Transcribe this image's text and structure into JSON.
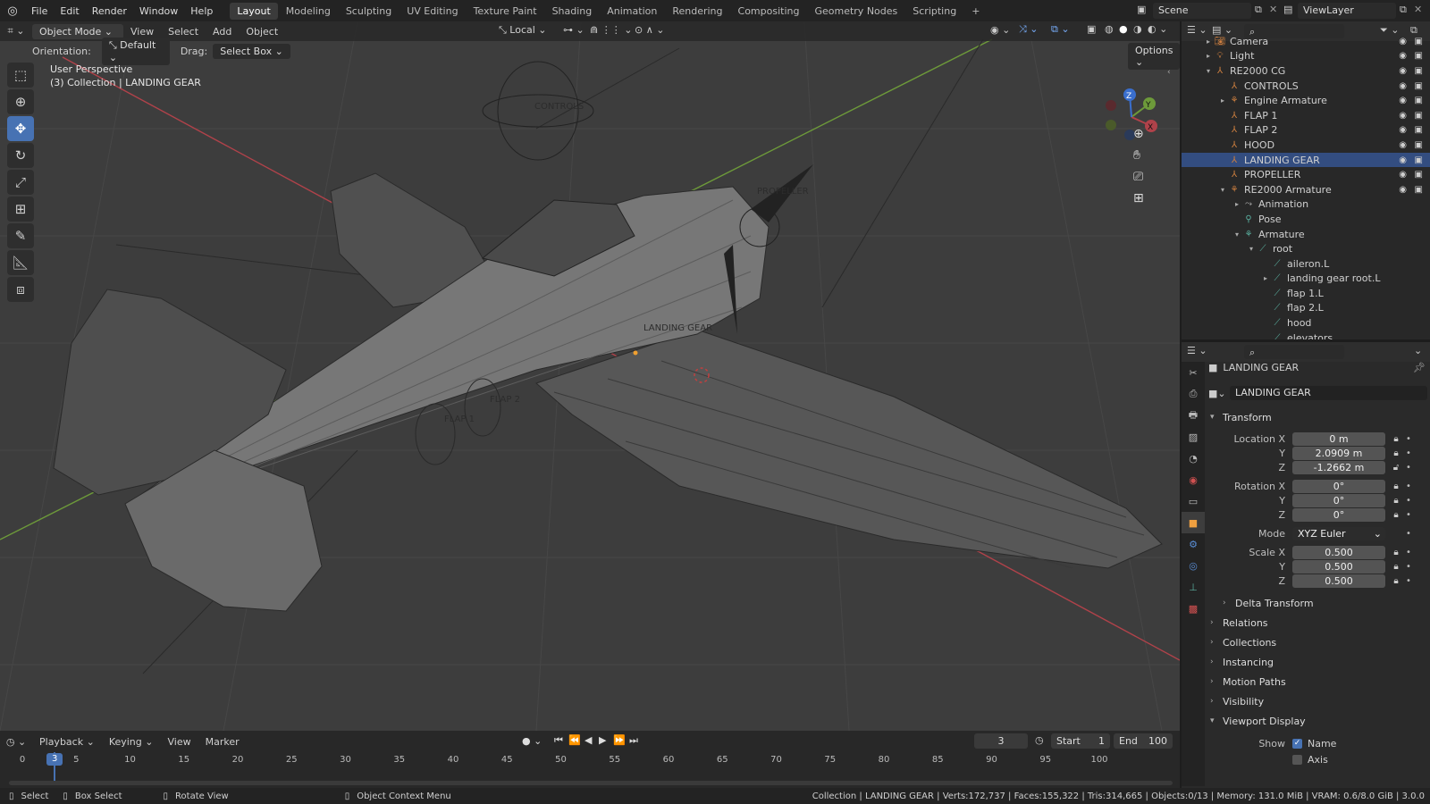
{
  "topbar": {
    "menus": [
      "File",
      "Edit",
      "Render",
      "Window",
      "Help"
    ],
    "workspaces": [
      "Layout",
      "Modeling",
      "Sculpting",
      "UV Editing",
      "Texture Paint",
      "Shading",
      "Animation",
      "Rendering",
      "Compositing",
      "Geometry Nodes",
      "Scripting"
    ],
    "active_workspace": "Layout",
    "add_tab": "+",
    "scene": "Scene",
    "view_layer": "ViewLayer"
  },
  "viewport": {
    "mode": "Object Mode",
    "menus": [
      "View",
      "Select",
      "Add",
      "Object"
    ],
    "transform_space": "Local",
    "orientation_label": "Orientation:",
    "orientation_value": "Default",
    "drag_label": "Drag:",
    "drag_value": "Select Box",
    "options": "Options",
    "overlay_line1": "User Perspective",
    "overlay_line2": "(3) Collection | LANDING GEAR",
    "labels": {
      "controls": "CONTROLS",
      "propeller": "PROPELLER",
      "landing_gear": "LANDING GEAR",
      "flap1": "FLAP 1",
      "flap2": "FLAP 2"
    },
    "gizmo": {
      "x": "X",
      "y": "Y",
      "z": "Z"
    }
  },
  "outliner": {
    "search_placeholder": "",
    "rows": [
      {
        "label": "Camera",
        "indent": 2,
        "tri": "▸",
        "icon": "camera-icon"
      },
      {
        "label": "Light",
        "indent": 2,
        "tri": "▸",
        "icon": "light-icon"
      },
      {
        "label": "RE2000 CG",
        "indent": 2,
        "tri": "▾",
        "icon": "empty-icon"
      },
      {
        "label": "CONTROLS",
        "indent": 3,
        "tri": "",
        "icon": "empty-icon"
      },
      {
        "label": "Engine Armature",
        "indent": 3,
        "tri": "▸",
        "icon": "armature-icon"
      },
      {
        "label": "FLAP 1",
        "indent": 3,
        "tri": "",
        "icon": "empty-icon"
      },
      {
        "label": "FLAP 2",
        "indent": 3,
        "tri": "",
        "icon": "empty-icon"
      },
      {
        "label": "HOOD",
        "indent": 3,
        "tri": "",
        "icon": "empty-icon"
      },
      {
        "label": "LANDING GEAR",
        "indent": 3,
        "tri": "",
        "icon": "empty-icon",
        "selected": true
      },
      {
        "label": "PROPELLER",
        "indent": 3,
        "tri": "",
        "icon": "empty-icon"
      },
      {
        "label": "RE2000 Armature",
        "indent": 3,
        "tri": "▾",
        "icon": "armature-icon"
      },
      {
        "label": "Animation",
        "indent": 4,
        "tri": "▸",
        "icon": "animation-icon"
      },
      {
        "label": "Pose",
        "indent": 4,
        "tri": "",
        "icon": "pose-icon"
      },
      {
        "label": "Armature",
        "indent": 4,
        "tri": "▾",
        "icon": "armature-data-icon"
      },
      {
        "label": "root",
        "indent": 5,
        "tri": "▾",
        "icon": "bone-icon"
      },
      {
        "label": "aileron.L",
        "indent": 6,
        "tri": "",
        "icon": "bone-icon"
      },
      {
        "label": "landing gear root.L",
        "indent": 6,
        "tri": "▸",
        "icon": "bone-icon"
      },
      {
        "label": "flap 1.L",
        "indent": 6,
        "tri": "",
        "icon": "bone-icon"
      },
      {
        "label": "flap 2.L",
        "indent": 6,
        "tri": "",
        "icon": "bone-icon"
      },
      {
        "label": "hood",
        "indent": 6,
        "tri": "",
        "icon": "bone-icon"
      },
      {
        "label": "elevators",
        "indent": 6,
        "tri": "",
        "icon": "bone-icon"
      }
    ]
  },
  "properties": {
    "header_object": "LANDING GEAR",
    "object_name": "LANDING GEAR",
    "transform_title": "Transform",
    "location": {
      "label": "Location X",
      "x": "0 m",
      "y": "2.0909 m",
      "z": "-1.2662 m"
    },
    "rotation": {
      "label": "Rotation X",
      "x": "0°",
      "y": "0°",
      "z": "0°"
    },
    "mode_label": "Mode",
    "mode_value": "XYZ Euler",
    "scale": {
      "label": "Scale X",
      "x": "0.500",
      "y": "0.500",
      "z": "0.500"
    },
    "axis_y": "Y",
    "axis_z": "Z",
    "delta": "Delta Transform",
    "panels": [
      "Relations",
      "Collections",
      "Instancing",
      "Motion Paths",
      "Visibility"
    ],
    "viewport_display": "Viewport Display",
    "show_label": "Show",
    "show_name": "Name",
    "show_axis": "Axis"
  },
  "timeline": {
    "menus": [
      "Playback",
      "Keying",
      "View",
      "Marker"
    ],
    "current_frame": "3",
    "start_label": "Start",
    "start": "1",
    "end_label": "End",
    "end": "100",
    "ticks": [
      "0",
      "5",
      "10",
      "15",
      "20",
      "25",
      "30",
      "35",
      "40",
      "45",
      "50",
      "55",
      "60",
      "65",
      "70",
      "75",
      "80",
      "85",
      "90",
      "95",
      "100"
    ],
    "playhead": "3"
  },
  "status": {
    "select": "Select",
    "box_select": "Box Select",
    "rotate_view": "Rotate View",
    "context_menu": "Object Context Menu",
    "stats": "Collection | LANDING GEAR | Verts:172,737 | Faces:155,322 | Tris:314,665 | Objects:0/13 | Memory: 131.0 MiB | VRAM: 0.6/8.0 GiB | 3.0.0"
  }
}
